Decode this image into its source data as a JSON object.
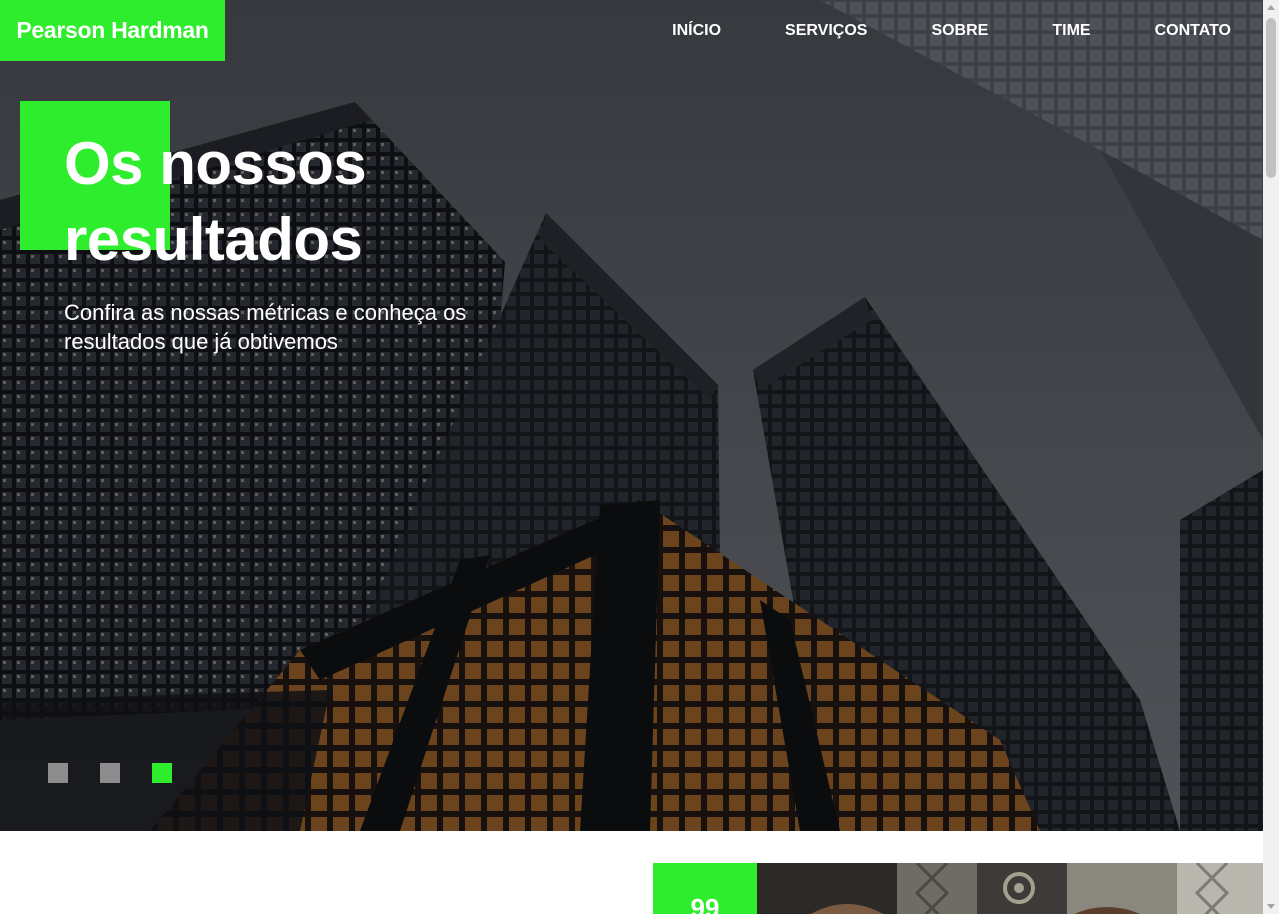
{
  "brand": {
    "name": "Pearson Hardman"
  },
  "nav": {
    "items": [
      "INÍCIO",
      "SERVIÇOS",
      "SOBRE",
      "TIME",
      "CONTATO"
    ]
  },
  "hero": {
    "title": "Os nossos resultados",
    "subtitle": "Confira as nossas métricas e conheça os resultados que já obtivemos",
    "slides": {
      "count": 3,
      "active_index": 2
    }
  },
  "lower": {
    "badge_text": "99"
  },
  "colors": {
    "accent": "#2ded2d",
    "dot_inactive": "#8d8d8d",
    "text_on_dark": "#ffffff"
  }
}
